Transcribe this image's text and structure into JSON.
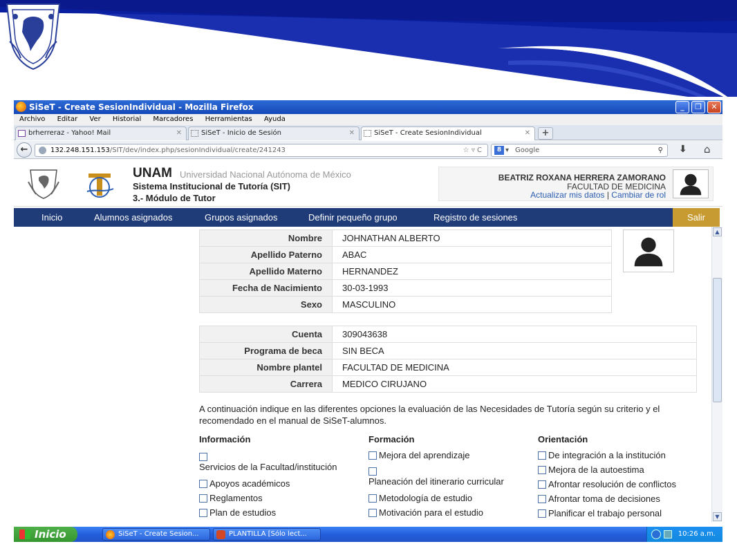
{
  "window": {
    "title": "SiSeT - Create SesionIndividual - Mozilla Firefox",
    "minimize": "_",
    "maximize": "❐",
    "close": "✕"
  },
  "menubar": [
    "Archivo",
    "Editar",
    "Ver",
    "Historial",
    "Marcadores",
    "Herramientas",
    "Ayuda"
  ],
  "tabs": [
    {
      "label": "brherreraz - Yahoo! Mail",
      "close": "✕"
    },
    {
      "label": "SiSeT - Inicio de Sesión",
      "close": "✕"
    },
    {
      "label": "SiSeT - Create SesionIndividual",
      "close": "✕"
    }
  ],
  "newtab": "+",
  "nav": {
    "back": "←",
    "url_host": "132.248.151.153",
    "url_path": "/SIT/dev/index.php/sesionIndividual/create/241243",
    "url_icons": "☆ ▿ C",
    "search_engine": "8",
    "search_placeholder": "Google",
    "search_icon": "⚲",
    "download": "⬇",
    "home": "⌂"
  },
  "site": {
    "title": "UNAM",
    "subtitle": "Universidad Nacional Autónoma de México",
    "system": "Sistema Institucional de Tutoría (SIT)",
    "module": "3.- Módulo de Tutor",
    "user_name": "BEATRIZ ROXANA HERRERA ZAMORANO",
    "user_faculty": "FACULTAD DE MEDICINA",
    "link_update": "Actualizar mis datos",
    "link_sep": " | ",
    "link_role": "Cambiar de rol"
  },
  "mainnav": [
    "Inicio",
    "Alumnos asignados",
    "Grupos asignados",
    "Definir pequeño grupo",
    "Registro de sesiones"
  ],
  "logout": "Salir",
  "student": [
    {
      "label": "Nombre",
      "value": "JOHNATHAN ALBERTO"
    },
    {
      "label": "Apellido Paterno",
      "value": "ABAC"
    },
    {
      "label": "Apellido Materno",
      "value": "HERNANDEZ"
    },
    {
      "label": "Fecha de Nacimiento",
      "value": "30-03-1993"
    },
    {
      "label": "Sexo",
      "value": "MASCULINO"
    }
  ],
  "academic": [
    {
      "label": "Cuenta",
      "value": "309043638"
    },
    {
      "label": "Programa de beca",
      "value": "SIN BECA"
    },
    {
      "label": "Nombre plantel",
      "value": "FACULTAD DE MEDICINA"
    },
    {
      "label": "Carrera",
      "value": "MEDICO CIRUJANO"
    }
  ],
  "intro": "A continuación indique en las diferentes opciones la evaluación de las Necesidades de Tutoría según su criterio y el recomendado en el manual de SiSeT-alumnos.",
  "columns": {
    "info": {
      "heading": "Información",
      "items": [
        "Servicios de la Facultad/institución",
        "Apoyos académicos",
        "Reglamentos",
        "Plan de estudios"
      ]
    },
    "formacion": {
      "heading": "Formación",
      "items": [
        "Mejora del aprendizaje",
        "Planeación del itinerario curricular",
        "Metodología de estudio",
        "Motivación para el estudio"
      ]
    },
    "orientacion": {
      "heading": "Orientación",
      "items": [
        "De integración a la institución",
        "Mejora de la autoestima",
        "Afrontar resolución de conflictos",
        "Afrontar toma de decisiones",
        "Planificar el trabajo personal"
      ]
    }
  },
  "scrollbar": {
    "up": "▲",
    "down": "▼"
  },
  "taskbar": {
    "start": "Inicio",
    "items": [
      "SiSeT - Create Sesion...",
      "PLANTILLA [Sólo lect..."
    ],
    "clock": "10:26 a.m."
  }
}
